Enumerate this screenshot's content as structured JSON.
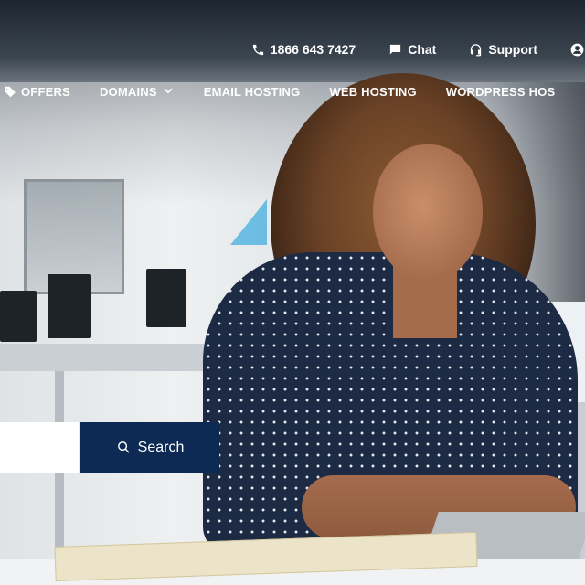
{
  "utility": {
    "phone_label": "1866 643 7427",
    "chat_label": "Chat",
    "support_label": "Support"
  },
  "nav": {
    "items": [
      {
        "label": "OFFERS",
        "icon": "tag-icon"
      },
      {
        "label": "DOMAINS",
        "icon": "chevron-down-icon"
      },
      {
        "label": "EMAIL HOSTING"
      },
      {
        "label": "WEB HOSTING"
      },
      {
        "label": "WORDPRESS HOS"
      }
    ]
  },
  "search": {
    "input_value": "",
    "placeholder": "",
    "button_label": "Search",
    "button_color": "#0d2a54"
  },
  "icons": {
    "phone": "phone-icon",
    "chat": "chat-bubble-icon",
    "support": "headset-icon",
    "account": "user-icon",
    "search": "search-icon"
  }
}
